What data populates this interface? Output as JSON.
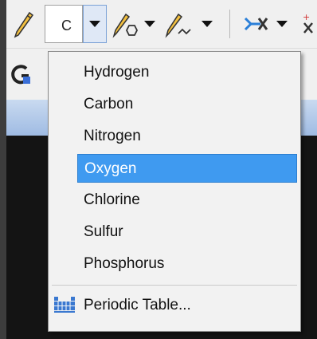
{
  "toolbar": {
    "element_value": "C",
    "icons": [
      "pencil-icon",
      "element-dropdown",
      "ring-pencil-icon",
      "chain-pencil-icon",
      "mapping-icon",
      "charge-icon",
      "query-icon"
    ]
  },
  "menu": {
    "items": [
      {
        "label": "Hydrogen",
        "selected": false
      },
      {
        "label": "Carbon",
        "selected": false
      },
      {
        "label": "Nitrogen",
        "selected": false
      },
      {
        "label": "Oxygen",
        "selected": true
      },
      {
        "label": "Chlorine",
        "selected": false
      },
      {
        "label": "Sulfur",
        "selected": false
      },
      {
        "label": "Phosphorus",
        "selected": false
      }
    ],
    "periodic_table_label": "Periodic Table..."
  },
  "colors": {
    "selection": "#3f9af0",
    "toolbar_bg": "#f0f0f0",
    "dark_area": "#141414"
  }
}
